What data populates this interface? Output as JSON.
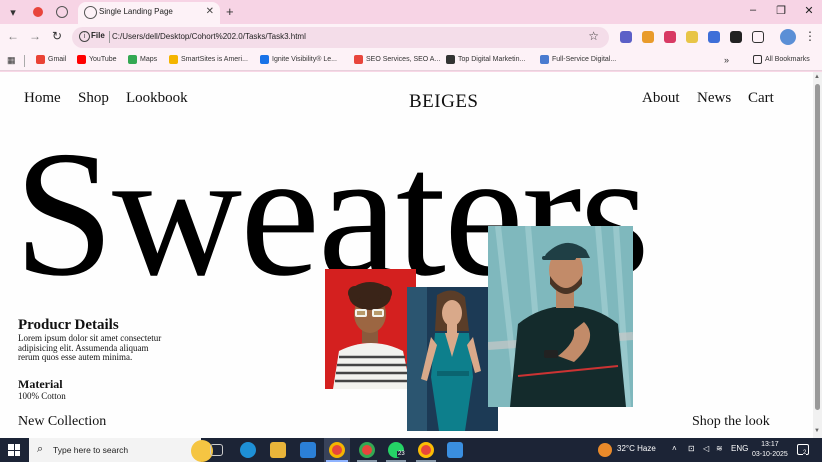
{
  "browser": {
    "tab_title": "Single Landing Page",
    "address_scheme": "File",
    "address_url": "C:/Users/dell/Desktop/Cohort%202.0/Tasks/Task3.html",
    "bookmarks": [
      {
        "label": "Gmail",
        "color": "#ea4335"
      },
      {
        "label": "YouTube",
        "color": "#ff0000"
      },
      {
        "label": "Maps",
        "color": "#34a853"
      },
      {
        "label": "SmartSites is Ameri...",
        "color": "#f4b400"
      },
      {
        "label": "Ignite Visibility® Le...",
        "color": "#1a73e8"
      },
      {
        "label": "SEO Services, SEO A...",
        "color": "#e8453c"
      },
      {
        "label": "Top Digital Marketin...",
        "color": "#333333"
      },
      {
        "label": "Full-Service Digital...",
        "color": "#4a7bd0"
      }
    ],
    "all_bookmarks": "All Bookmarks"
  },
  "site": {
    "nav_left": [
      "Home",
      "Shop",
      "Lookbook"
    ],
    "brand": "BEIGES",
    "nav_right": [
      "About",
      "News",
      "Cart"
    ],
    "hero": "Sweaters",
    "details_title": "Producr Details",
    "details_body": "Lorem ipsum dolor sit amet consectetur adipisicing elit. Assumenda aliquam rerum quos esse autem minima.",
    "material_title": "Material",
    "material_body": "100% Cotton",
    "new_collection": "New Collection",
    "shop_the_look": "Shop the look"
  },
  "taskbar": {
    "search_placeholder": "Type here to search",
    "weather": "32°C  Haze",
    "language": "ENG",
    "time": "13:17",
    "date": "03-10-2025",
    "whatsapp_badge": "23",
    "notification_count": "2"
  },
  "colors": {
    "tabstrip": "#f7d4e5",
    "toolbar": "#fdf2f7",
    "taskbar": "#1c2436",
    "photo1_bg": "#d4201f",
    "photo2_bg": "#1c3a55",
    "photo3_bg": "#7fb8bd"
  }
}
